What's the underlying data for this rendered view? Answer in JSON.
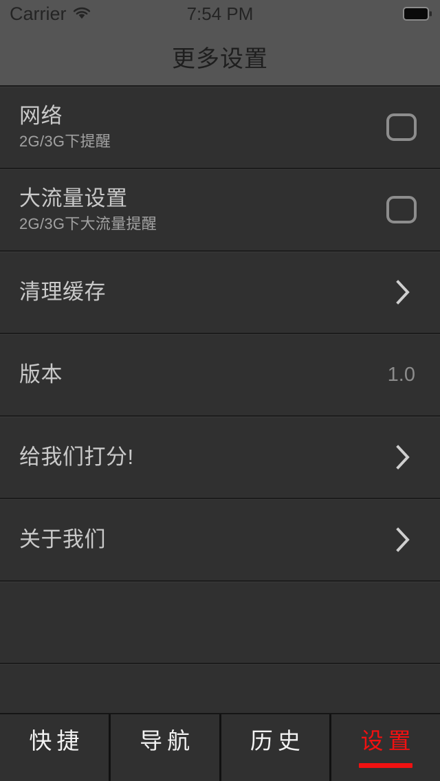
{
  "status_bar": {
    "carrier": "Carrier",
    "wifi_icon": "wifi-icon",
    "time": "7:54 PM",
    "battery_icon": "battery-full-icon"
  },
  "navbar": {
    "title": "更多设置"
  },
  "settings_rows": [
    {
      "name": "network",
      "title": "网络",
      "subtitle": "2G/3G下提醒",
      "accessory": "checkbox",
      "checked": false
    },
    {
      "name": "large-traffic",
      "title": "大流量设置",
      "subtitle": "2G/3G下大流量提醒",
      "accessory": "checkbox",
      "checked": false
    },
    {
      "name": "clear-cache",
      "title": "清理缓存",
      "subtitle": "",
      "accessory": "chevron"
    },
    {
      "name": "version",
      "title": "版本",
      "subtitle": "",
      "accessory": "value",
      "value": "1.0"
    },
    {
      "name": "rate-us",
      "title": "给我们打分!",
      "subtitle": "",
      "accessory": "chevron"
    },
    {
      "name": "about-us",
      "title": "关于我们",
      "subtitle": "",
      "accessory": "chevron"
    },
    {
      "name": "empty-1",
      "title": "",
      "subtitle": "",
      "accessory": "none"
    },
    {
      "name": "empty-2",
      "title": "",
      "subtitle": "",
      "accessory": "none"
    }
  ],
  "tabbar": {
    "active_index": 3,
    "active_color": "#f01111",
    "inactive_color": "#f2f2f2",
    "tabs": [
      {
        "name": "shortcut",
        "label": "快捷"
      },
      {
        "name": "navigation",
        "label": "导航"
      },
      {
        "name": "history",
        "label": "历史"
      },
      {
        "name": "settings",
        "label": "设置"
      }
    ]
  }
}
